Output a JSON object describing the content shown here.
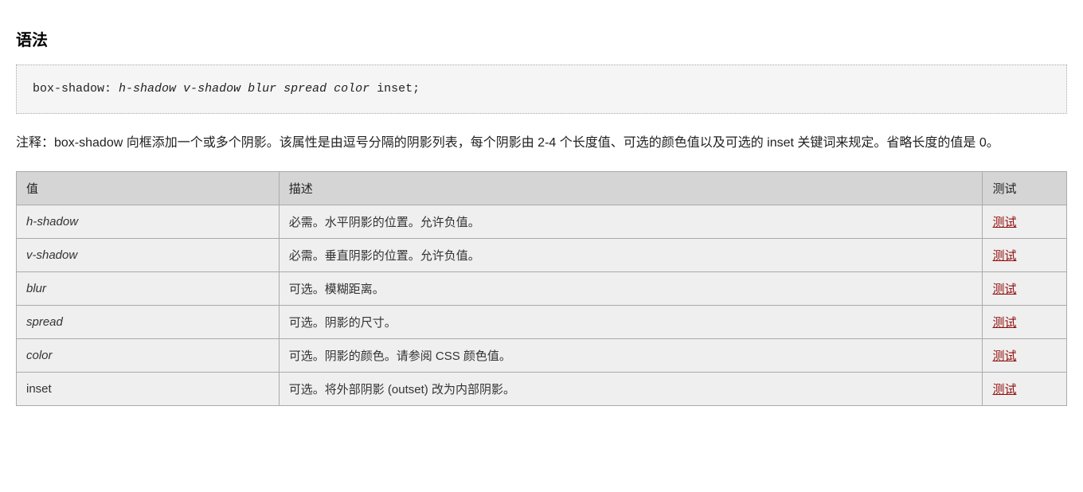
{
  "heading": "语法",
  "syntax": {
    "property": "box-shadow:",
    "params": "h-shadow v-shadow blur spread color",
    "suffix": "inset;"
  },
  "note": "注释：box-shadow 向框添加一个或多个阴影。该属性是由逗号分隔的阴影列表，每个阴影由 2-4 个长度值、可选的颜色值以及可选的 inset 关键词来规定。省略长度的值是 0。",
  "table": {
    "headers": {
      "value": "值",
      "desc": "描述",
      "test": "测试"
    },
    "rows": [
      {
        "value": "h-shadow",
        "desc": "必需。水平阴影的位置。允许负值。",
        "test": "测试",
        "italic": true
      },
      {
        "value": "v-shadow",
        "desc": "必需。垂直阴影的位置。允许负值。",
        "test": "测试",
        "italic": true
      },
      {
        "value": "blur",
        "desc": "可选。模糊距离。",
        "test": "测试",
        "italic": true
      },
      {
        "value": "spread",
        "desc": "可选。阴影的尺寸。",
        "test": "测试",
        "italic": true
      },
      {
        "value": "color",
        "desc": "可选。阴影的颜色。请参阅 CSS 颜色值。",
        "test": "测试",
        "italic": true
      },
      {
        "value": "inset",
        "desc": "可选。将外部阴影 (outset) 改为内部阴影。",
        "test": "测试",
        "italic": false
      }
    ]
  }
}
